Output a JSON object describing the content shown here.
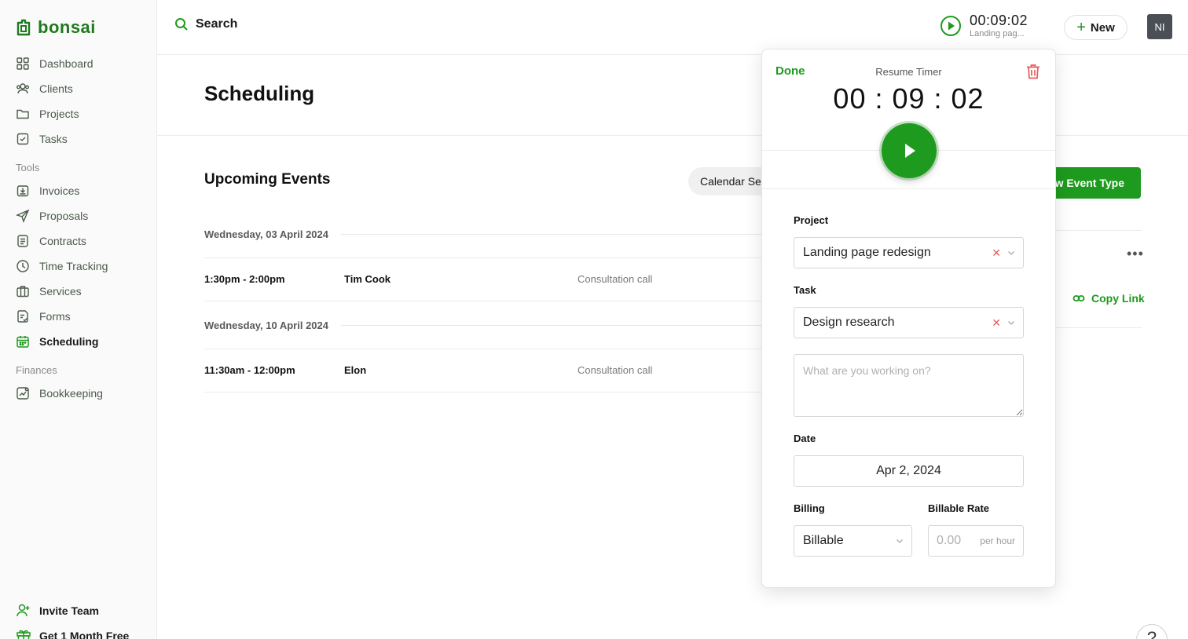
{
  "app": {
    "logo_text": "bonsai",
    "accent_color": "#1e9a1e"
  },
  "sidebar": {
    "items": [
      {
        "label": "Dashboard",
        "icon": "grid-icon"
      },
      {
        "label": "Clients",
        "icon": "users-icon"
      },
      {
        "label": "Projects",
        "icon": "folder-icon"
      },
      {
        "label": "Tasks",
        "icon": "check-square-icon"
      }
    ],
    "tools_heading": "Tools",
    "tools": [
      {
        "label": "Invoices",
        "icon": "invoice-icon"
      },
      {
        "label": "Proposals",
        "icon": "send-icon"
      },
      {
        "label": "Contracts",
        "icon": "document-icon"
      },
      {
        "label": "Time Tracking",
        "icon": "clock-icon"
      },
      {
        "label": "Services",
        "icon": "briefcase-icon"
      },
      {
        "label": "Forms",
        "icon": "form-icon"
      },
      {
        "label": "Scheduling",
        "icon": "calendar-icon",
        "active": true
      }
    ],
    "finances_heading": "Finances",
    "finances": [
      {
        "label": "Bookkeeping",
        "icon": "chart-icon"
      }
    ],
    "invite_label": "Invite Team",
    "promo_label": "Get 1 Month Free"
  },
  "topbar": {
    "search_label": "Search",
    "timer_time": "00:09:02",
    "timer_task": "Landing pag...",
    "new_label": "New",
    "avatar_initials": "NI"
  },
  "page": {
    "title": "Scheduling"
  },
  "events": {
    "heading": "Upcoming Events",
    "calendar_button": "Calendar Se",
    "new_event_type_button": "ew Event Type",
    "copy_link_label": "Copy Link",
    "groups": [
      {
        "date": "Wednesday, 03 April 2024",
        "time": "1:30pm - 2:00pm",
        "name": "Tim Cook",
        "type": "Consultation call"
      },
      {
        "date": "Wednesday, 10 April 2024",
        "time": "11:30am - 12:00pm",
        "name": "Elon",
        "type": "Consultation call"
      }
    ]
  },
  "timer_popover": {
    "done_label": "Done",
    "resume_label": "Resume Timer",
    "time": "00 : 09 : 02",
    "project_label": "Project",
    "project_value": "Landing page redesign",
    "task_label": "Task",
    "task_value": "Design research",
    "notes_placeholder": "What are you working on?",
    "date_label": "Date",
    "date_value": "Apr 2, 2024",
    "billing_label": "Billing",
    "billing_value": "Billable",
    "rate_label": "Billable Rate",
    "rate_placeholder": "0.00",
    "rate_unit": "per hour"
  },
  "help_label": "?"
}
